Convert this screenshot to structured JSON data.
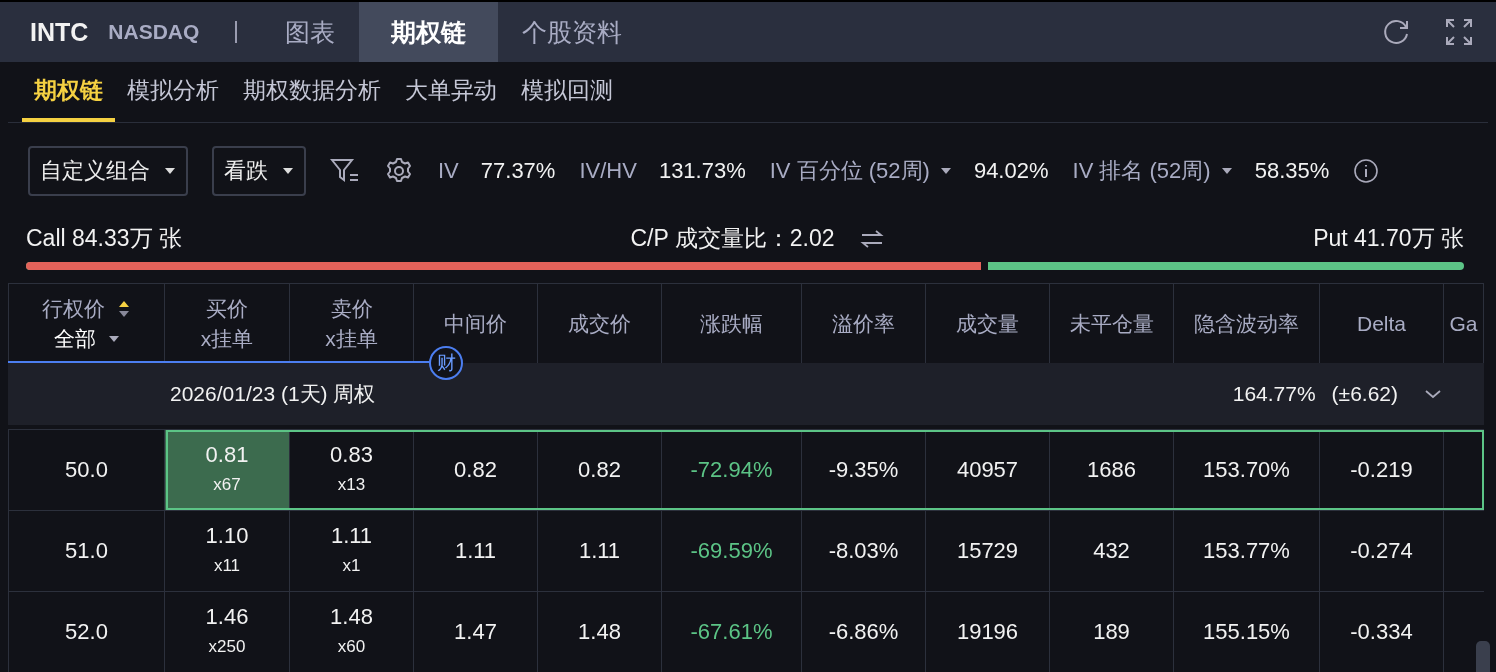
{
  "header": {
    "symbol": "INTC",
    "exchange": "NASDAQ",
    "tabs": [
      {
        "label": "图表",
        "selected": false
      },
      {
        "label": "期权链",
        "selected": true
      },
      {
        "label": "个股资料",
        "selected": false
      }
    ]
  },
  "subtabs": [
    {
      "label": "期权链",
      "selected": true
    },
    {
      "label": "模拟分析",
      "selected": false
    },
    {
      "label": "期权数据分析",
      "selected": false
    },
    {
      "label": "大单异动",
      "selected": false
    },
    {
      "label": "模拟回测",
      "selected": false
    }
  ],
  "toolbar": {
    "strategy": "自定义组合",
    "direction": "看跌",
    "stats": [
      {
        "label": "IV",
        "value": "77.37%",
        "dropdown": false
      },
      {
        "label": "IV/HV",
        "value": "131.73%",
        "dropdown": false
      },
      {
        "label": "IV 百分位 (52周)",
        "value": "94.02%",
        "dropdown": true
      },
      {
        "label": "IV 排名 (52周)",
        "value": "58.35%",
        "dropdown": true
      }
    ]
  },
  "volume": {
    "call": "Call 84.33万 张",
    "ratio": "C/P 成交量比：2.02",
    "put": "Put 41.70万 张",
    "level": 0.669
  },
  "table": {
    "strike_header": "行权价",
    "strike_filter": "全部",
    "columns": [
      "买价\nx挂单",
      "卖价\nx挂单",
      "中间价",
      "成交价",
      "涨跌幅",
      "溢价率",
      "成交量",
      "未平仓量",
      "隐含波动率",
      "Delta",
      "Ga"
    ],
    "badge": "财",
    "group": {
      "date": "2026/01/23 (1天) 周权",
      "iv": "164.77%",
      "move": "(±6.62)",
      "expanded": false
    },
    "rows": [
      {
        "strike": "50.0",
        "bid": "0.81",
        "bid_size": "x67",
        "ask": "0.83",
        "ask_size": "x13",
        "mid": "0.82",
        "last": "0.82",
        "change": "-72.94%",
        "premium": "-9.35%",
        "volume": "40957",
        "oi": "1686",
        "iv": "153.70%",
        "delta": "-0.219",
        "selected": true,
        "bid_selected": true
      },
      {
        "strike": "51.0",
        "bid": "1.10",
        "bid_size": "x11",
        "ask": "1.11",
        "ask_size": "x1",
        "mid": "1.11",
        "last": "1.11",
        "change": "-69.59%",
        "premium": "-8.03%",
        "volume": "15729",
        "oi": "432",
        "iv": "153.77%",
        "delta": "-0.274",
        "selected": false,
        "bid_selected": false
      },
      {
        "strike": "52.0",
        "bid": "1.46",
        "bid_size": "x250",
        "ask": "1.48",
        "ask_size": "x60",
        "mid": "1.47",
        "last": "1.48",
        "change": "-67.61%",
        "premium": "-6.86%",
        "volume": "19196",
        "oi": "189",
        "iv": "155.15%",
        "delta": "-0.334",
        "selected": false,
        "bid_selected": false
      }
    ]
  }
}
